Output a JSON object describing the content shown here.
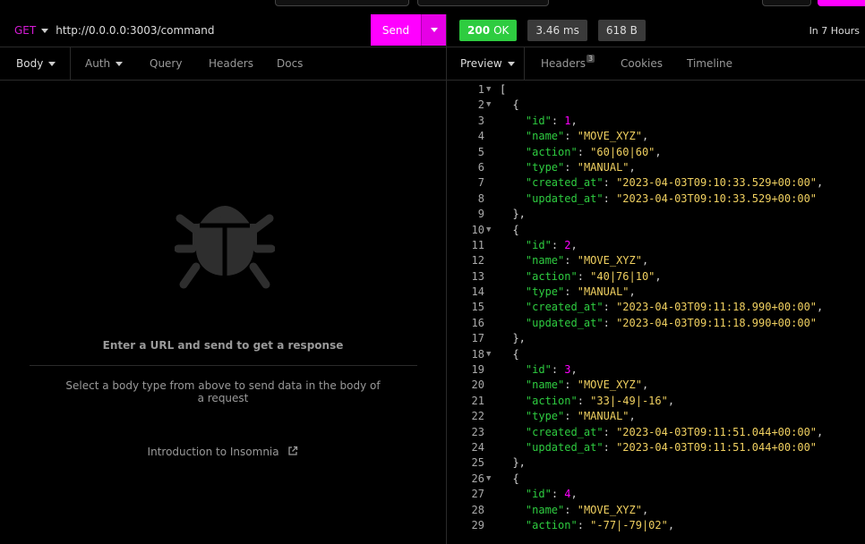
{
  "request": {
    "method": "GET",
    "url": "http://0.0.0.0:3003/command",
    "send_label": "Send"
  },
  "request_tabs": [
    {
      "label": "Body"
    },
    {
      "label": "Auth"
    },
    {
      "label": "Query"
    },
    {
      "label": "Headers"
    },
    {
      "label": "Docs"
    }
  ],
  "empty_state": {
    "title": "Enter a URL and send to get a response",
    "body_hint": "Select a body type from above to send data in the body of a request",
    "intro_link": "Introduction to Insomnia"
  },
  "response": {
    "status_code": "200",
    "status_text": "OK",
    "time": "3.46 ms",
    "size": "618 B",
    "age": "In 7 Hours"
  },
  "response_tabs": [
    {
      "label": "Preview"
    },
    {
      "label": "Headers",
      "badge": "3"
    },
    {
      "label": "Cookies"
    },
    {
      "label": "Timeline"
    }
  ],
  "colors": {
    "accent": "#ff00ff",
    "ok": "#2ecc40",
    "key": "#2ecc40",
    "string": "#f0d060",
    "number": "#ff00ff"
  },
  "code_lines": [
    {
      "n": "1",
      "fold": true,
      "indent": "",
      "parts": [
        [
          "p",
          "["
        ]
      ]
    },
    {
      "n": "2",
      "fold": true,
      "indent": "  ",
      "parts": [
        [
          "p",
          "{"
        ]
      ]
    },
    {
      "n": "3",
      "fold": false,
      "indent": "    ",
      "parts": [
        [
          "k",
          "\"id\""
        ],
        [
          "p",
          ": "
        ],
        [
          "n",
          "1"
        ],
        [
          "p",
          ","
        ]
      ]
    },
    {
      "n": "4",
      "fold": false,
      "indent": "    ",
      "parts": [
        [
          "k",
          "\"name\""
        ],
        [
          "p",
          ": "
        ],
        [
          "s",
          "\"MOVE_XYZ\""
        ],
        [
          "p",
          ","
        ]
      ]
    },
    {
      "n": "5",
      "fold": false,
      "indent": "    ",
      "parts": [
        [
          "k",
          "\"action\""
        ],
        [
          "p",
          ": "
        ],
        [
          "s",
          "\"60|60|60\""
        ],
        [
          "p",
          ","
        ]
      ]
    },
    {
      "n": "6",
      "fold": false,
      "indent": "    ",
      "parts": [
        [
          "k",
          "\"type\""
        ],
        [
          "p",
          ": "
        ],
        [
          "s",
          "\"MANUAL\""
        ],
        [
          "p",
          ","
        ]
      ]
    },
    {
      "n": "7",
      "fold": false,
      "indent": "    ",
      "parts": [
        [
          "k",
          "\"created_at\""
        ],
        [
          "p",
          ": "
        ],
        [
          "s",
          "\"2023-04-03T09:10:33.529+00:00\""
        ],
        [
          "p",
          ","
        ]
      ]
    },
    {
      "n": "8",
      "fold": false,
      "indent": "    ",
      "parts": [
        [
          "k",
          "\"updated_at\""
        ],
        [
          "p",
          ": "
        ],
        [
          "s",
          "\"2023-04-03T09:10:33.529+00:00\""
        ]
      ]
    },
    {
      "n": "9",
      "fold": false,
      "indent": "  ",
      "parts": [
        [
          "p",
          "},"
        ]
      ]
    },
    {
      "n": "10",
      "fold": true,
      "indent": "  ",
      "parts": [
        [
          "p",
          "{"
        ]
      ]
    },
    {
      "n": "11",
      "fold": false,
      "indent": "    ",
      "parts": [
        [
          "k",
          "\"id\""
        ],
        [
          "p",
          ": "
        ],
        [
          "n",
          "2"
        ],
        [
          "p",
          ","
        ]
      ]
    },
    {
      "n": "12",
      "fold": false,
      "indent": "    ",
      "parts": [
        [
          "k",
          "\"name\""
        ],
        [
          "p",
          ": "
        ],
        [
          "s",
          "\"MOVE_XYZ\""
        ],
        [
          "p",
          ","
        ]
      ]
    },
    {
      "n": "13",
      "fold": false,
      "indent": "    ",
      "parts": [
        [
          "k",
          "\"action\""
        ],
        [
          "p",
          ": "
        ],
        [
          "s",
          "\"40|76|10\""
        ],
        [
          "p",
          ","
        ]
      ]
    },
    {
      "n": "14",
      "fold": false,
      "indent": "    ",
      "parts": [
        [
          "k",
          "\"type\""
        ],
        [
          "p",
          ": "
        ],
        [
          "s",
          "\"MANUAL\""
        ],
        [
          "p",
          ","
        ]
      ]
    },
    {
      "n": "15",
      "fold": false,
      "indent": "    ",
      "parts": [
        [
          "k",
          "\"created_at\""
        ],
        [
          "p",
          ": "
        ],
        [
          "s",
          "\"2023-04-03T09:11:18.990+00:00\""
        ],
        [
          "p",
          ","
        ]
      ]
    },
    {
      "n": "16",
      "fold": false,
      "indent": "    ",
      "parts": [
        [
          "k",
          "\"updated_at\""
        ],
        [
          "p",
          ": "
        ],
        [
          "s",
          "\"2023-04-03T09:11:18.990+00:00\""
        ]
      ]
    },
    {
      "n": "17",
      "fold": false,
      "indent": "  ",
      "parts": [
        [
          "p",
          "},"
        ]
      ]
    },
    {
      "n": "18",
      "fold": true,
      "indent": "  ",
      "parts": [
        [
          "p",
          "{"
        ]
      ]
    },
    {
      "n": "19",
      "fold": false,
      "indent": "    ",
      "parts": [
        [
          "k",
          "\"id\""
        ],
        [
          "p",
          ": "
        ],
        [
          "n",
          "3"
        ],
        [
          "p",
          ","
        ]
      ]
    },
    {
      "n": "20",
      "fold": false,
      "indent": "    ",
      "parts": [
        [
          "k",
          "\"name\""
        ],
        [
          "p",
          ": "
        ],
        [
          "s",
          "\"MOVE_XYZ\""
        ],
        [
          "p",
          ","
        ]
      ]
    },
    {
      "n": "21",
      "fold": false,
      "indent": "    ",
      "parts": [
        [
          "k",
          "\"action\""
        ],
        [
          "p",
          ": "
        ],
        [
          "s",
          "\"33|-49|-16\""
        ],
        [
          "p",
          ","
        ]
      ]
    },
    {
      "n": "22",
      "fold": false,
      "indent": "    ",
      "parts": [
        [
          "k",
          "\"type\""
        ],
        [
          "p",
          ": "
        ],
        [
          "s",
          "\"MANUAL\""
        ],
        [
          "p",
          ","
        ]
      ]
    },
    {
      "n": "23",
      "fold": false,
      "indent": "    ",
      "parts": [
        [
          "k",
          "\"created_at\""
        ],
        [
          "p",
          ": "
        ],
        [
          "s",
          "\"2023-04-03T09:11:51.044+00:00\""
        ],
        [
          "p",
          ","
        ]
      ]
    },
    {
      "n": "24",
      "fold": false,
      "indent": "    ",
      "parts": [
        [
          "k",
          "\"updated_at\""
        ],
        [
          "p",
          ": "
        ],
        [
          "s",
          "\"2023-04-03T09:11:51.044+00:00\""
        ]
      ]
    },
    {
      "n": "25",
      "fold": false,
      "indent": "  ",
      "parts": [
        [
          "p",
          "},"
        ]
      ]
    },
    {
      "n": "26",
      "fold": true,
      "indent": "  ",
      "parts": [
        [
          "p",
          "{"
        ]
      ]
    },
    {
      "n": "27",
      "fold": false,
      "indent": "    ",
      "parts": [
        [
          "k",
          "\"id\""
        ],
        [
          "p",
          ": "
        ],
        [
          "n",
          "4"
        ],
        [
          "p",
          ","
        ]
      ]
    },
    {
      "n": "28",
      "fold": false,
      "indent": "    ",
      "parts": [
        [
          "k",
          "\"name\""
        ],
        [
          "p",
          ": "
        ],
        [
          "s",
          "\"MOVE_XYZ\""
        ],
        [
          "p",
          ","
        ]
      ]
    },
    {
      "n": "29",
      "fold": false,
      "indent": "    ",
      "parts": [
        [
          "k",
          "\"action\""
        ],
        [
          "p",
          ": "
        ],
        [
          "s",
          "\"-77|-79|02\""
        ],
        [
          "p",
          ","
        ]
      ]
    }
  ]
}
